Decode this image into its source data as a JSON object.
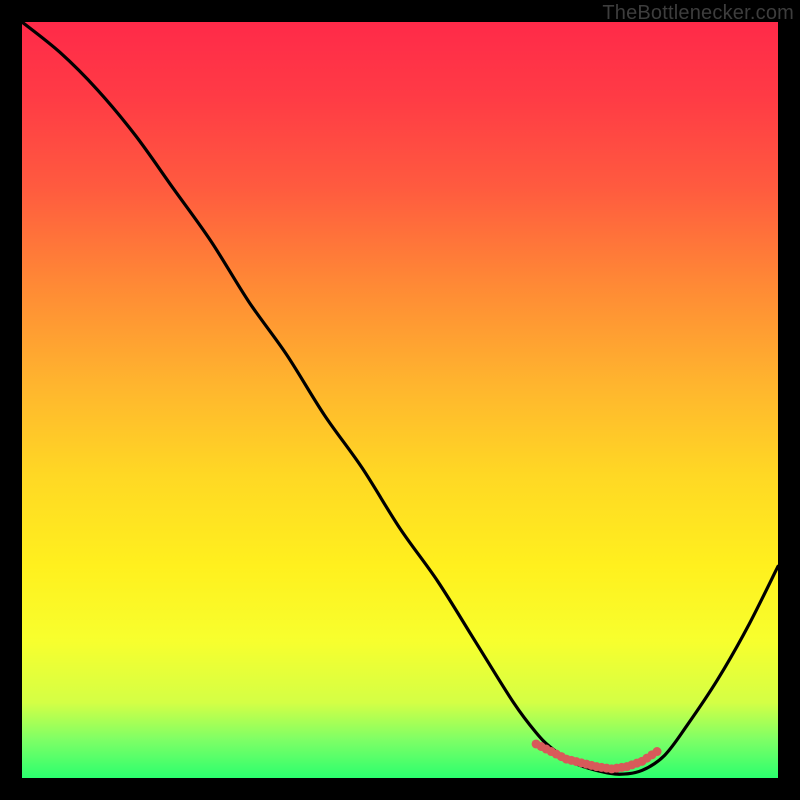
{
  "watermark": "TheBottlenecker.com",
  "chart_data": {
    "type": "line",
    "title": "",
    "xlabel": "",
    "ylabel": "",
    "xlim": [
      0,
      100
    ],
    "ylim": [
      0,
      100
    ],
    "background_gradient": {
      "top": "#ff2a49",
      "bottom": "#2bff6e",
      "meaning": "red=high bottleneck, green=low bottleneck"
    },
    "series": [
      {
        "name": "bottleneck-curve",
        "color": "#000000",
        "x": [
          0,
          5,
          10,
          15,
          20,
          25,
          30,
          35,
          40,
          45,
          50,
          55,
          60,
          65,
          68,
          70,
          73,
          76,
          79,
          82,
          85,
          88,
          92,
          96,
          100
        ],
        "values": [
          100,
          96,
          91,
          85,
          78,
          71,
          63,
          56,
          48,
          41,
          33,
          26,
          18,
          10,
          6,
          4,
          2,
          1,
          0.5,
          1,
          3,
          7,
          13,
          20,
          28
        ]
      },
      {
        "name": "optimal-band-marker",
        "color": "#d85a5a",
        "style": "dotted",
        "x": [
          68,
          70,
          72,
          74,
          76,
          78,
          80,
          82,
          84
        ],
        "values": [
          4.5,
          3.5,
          2.5,
          2,
          1.5,
          1.2,
          1.5,
          2.2,
          3.5
        ]
      }
    ],
    "interpretation": "Curve reaches near-zero (optimal / no bottleneck) around x≈78; values rise steeply toward both ends."
  }
}
